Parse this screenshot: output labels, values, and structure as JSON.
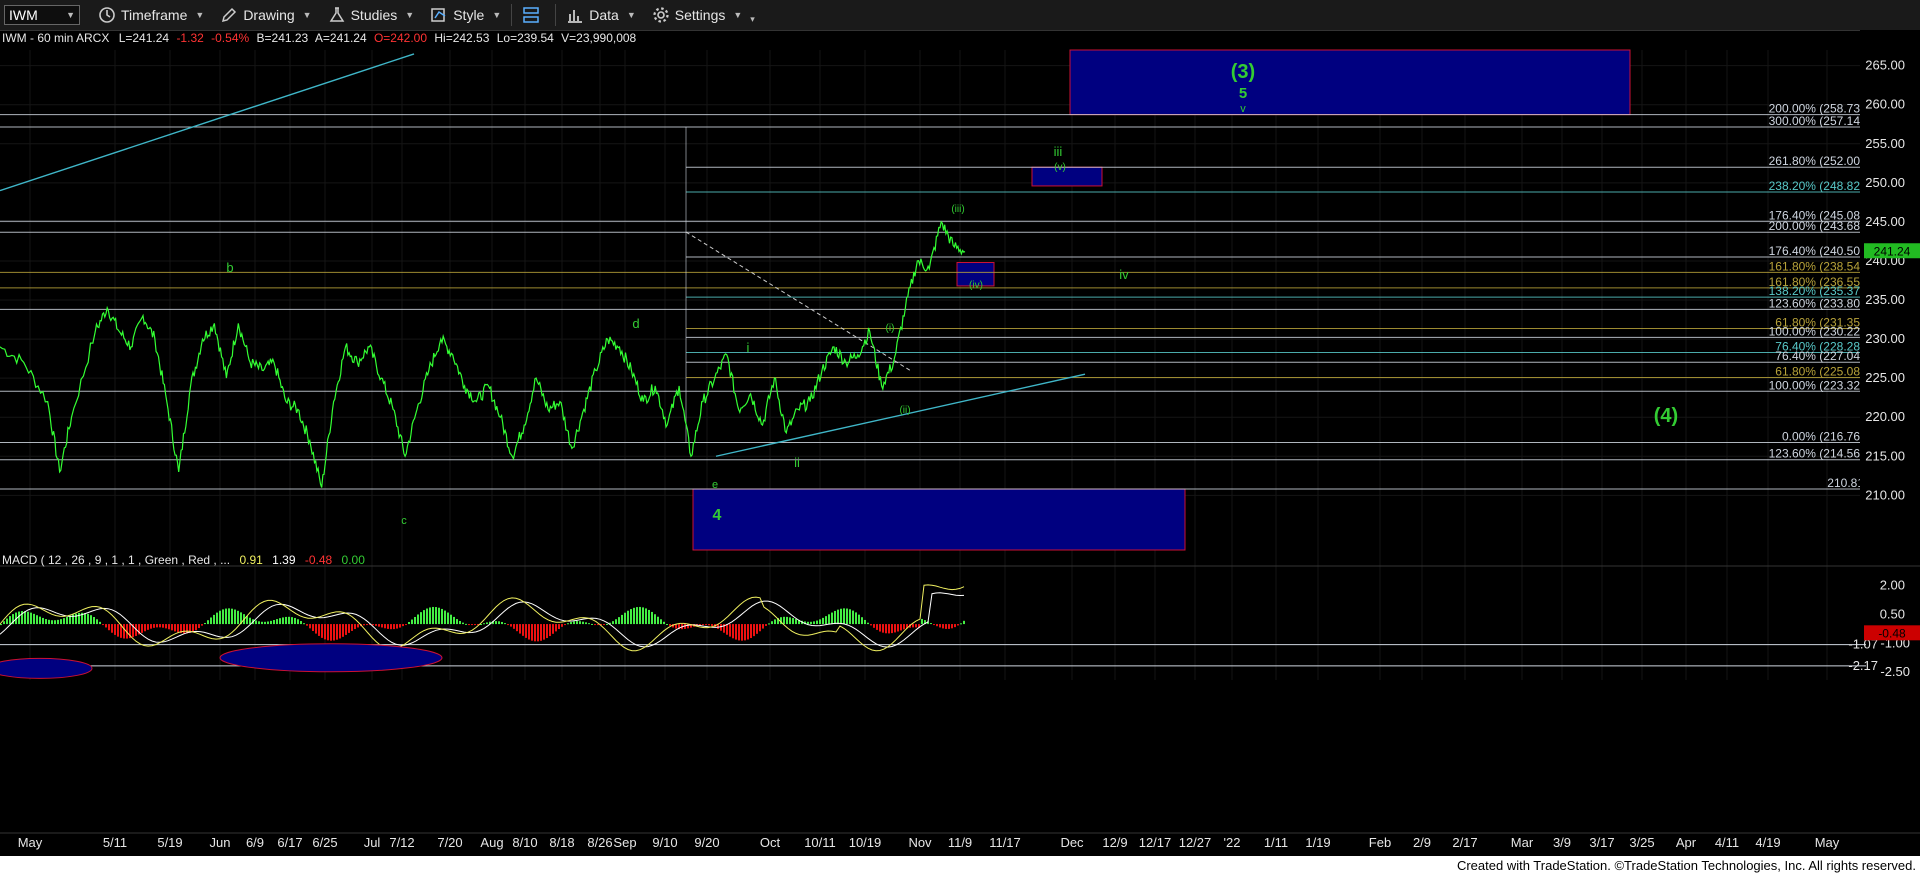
{
  "toolbar": {
    "symbol": "IWM",
    "timeframe_label": "Timeframe",
    "drawing_label": "Drawing",
    "studies_label": "Studies",
    "style_label": "Style",
    "data_label": "Data",
    "settings_label": "Settings"
  },
  "header": {
    "info": "IWM - 60 min  ARCX",
    "last": "L=241.24",
    "change": "-1.32",
    "change_pct": "-0.54%",
    "bid": "B=241.23",
    "ask": "A=241.24",
    "open": "O=242.00",
    "high": "Hi=242.53",
    "low": "Lo=239.54",
    "volume": "V=23,990,008"
  },
  "macd": {
    "title": "MACD ( 12 , 26 , 9 , 1 , 1 , Green , Red , ...",
    "v1": "0.91",
    "v2": "1.39",
    "v3": "-0.48",
    "v4": "0.00"
  },
  "colors": {
    "price": "#33ff33",
    "wave_label": "#33cc33",
    "box_fill": "#000080",
    "box_border": "#cc1133",
    "fib_white": "#cfd6e0",
    "fib_cyan": "#58c8c8",
    "fib_gold": "#b8a33a",
    "trendline": "#3fb6c8",
    "macd_up": "#44ee44",
    "macd_down": "#ee1111",
    "macd_line1": "#f0f060",
    "macd_line2": "#ffffff",
    "last_price_tag": "#22bb22"
  },
  "footer": {
    "text": "Created with TradeStation. ©TradeStation Technologies, Inc. All rights reserved."
  },
  "chart_data": {
    "type": "line",
    "title": "IWM - 60 min ARCX",
    "xlabel": "",
    "ylabel": "",
    "ylim": [
      203,
      267
    ],
    "x_tick_labels": [
      "May",
      "5/11",
      "5/19",
      "Jun",
      "6/9",
      "6/17",
      "6/25",
      "Jul",
      "7/12",
      "7/20",
      "Aug",
      "8/10",
      "8/18",
      "8/26",
      "Sep",
      "9/10",
      "9/20",
      "Oct",
      "10/11",
      "10/19",
      "Nov",
      "11/9",
      "11/17",
      "Dec",
      "12/9",
      "12/17",
      "12/27",
      "'22",
      "1/11",
      "1/19",
      "Feb",
      "2/9",
      "2/17",
      "Mar",
      "3/9",
      "3/17",
      "3/25",
      "Apr",
      "4/11",
      "4/19",
      "May"
    ],
    "y_ticks": [
      210,
      215,
      220,
      225,
      230,
      235,
      240,
      245,
      250,
      255,
      260,
      265
    ],
    "last_price": "241.24",
    "series": [
      {
        "points": [
          [
            0,
            229
          ],
          [
            2,
            227
          ],
          [
            4,
            222
          ],
          [
            5,
            213
          ],
          [
            6,
            220
          ],
          [
            8,
            231
          ],
          [
            9,
            234
          ],
          [
            10,
            231
          ],
          [
            11,
            229
          ],
          [
            12,
            233
          ],
          [
            13,
            230
          ],
          [
            14,
            222
          ],
          [
            15,
            213
          ],
          [
            16,
            224
          ],
          [
            17,
            230
          ],
          [
            18,
            232
          ],
          [
            19,
            225
          ],
          [
            20,
            232
          ],
          [
            21,
            227
          ],
          [
            22,
            226
          ],
          [
            23,
            227
          ],
          [
            24,
            222
          ],
          [
            25,
            221
          ],
          [
            26,
            217
          ],
          [
            27,
            211
          ],
          [
            28,
            222
          ],
          [
            29,
            229
          ],
          [
            30,
            227
          ],
          [
            31,
            229
          ],
          [
            32,
            225
          ],
          [
            33,
            221
          ],
          [
            34,
            215
          ],
          [
            35,
            221
          ],
          [
            36,
            226
          ],
          [
            37,
            230
          ],
          [
            38,
            228
          ],
          [
            39,
            224
          ],
          [
            40,
            222
          ],
          [
            41,
            224
          ],
          [
            42,
            220
          ],
          [
            43,
            215
          ],
          [
            44,
            219
          ],
          [
            45,
            225
          ],
          [
            46,
            221
          ],
          [
            47,
            222
          ],
          [
            48,
            216
          ],
          [
            49,
            221
          ],
          [
            50,
            226
          ],
          [
            51,
            230
          ],
          [
            52,
            229
          ],
          [
            53,
            226
          ],
          [
            54,
            222
          ],
          [
            55,
            224
          ],
          [
            56,
            219
          ],
          [
            57,
            224
          ],
          [
            58,
            215
          ],
          [
            59,
            222
          ],
          [
            60,
            225
          ],
          [
            61,
            228
          ],
          [
            62,
            221
          ],
          [
            63,
            223
          ],
          [
            64,
            219
          ],
          [
            65,
            225
          ],
          [
            66,
            218
          ],
          [
            67,
            221
          ],
          [
            68,
            222
          ],
          [
            69,
            226
          ],
          [
            70,
            229
          ],
          [
            71,
            227
          ],
          [
            72,
            228
          ],
          [
            73,
            231
          ],
          [
            74,
            224
          ],
          [
            75,
            227
          ],
          [
            76,
            234
          ],
          [
            77,
            240
          ],
          [
            78,
            239
          ],
          [
            79,
            245
          ],
          [
            80,
            242
          ],
          [
            81,
            241.2
          ]
        ]
      }
    ],
    "fib_levels": [
      {
        "label": "200.00% (258.73)",
        "value": 258.73,
        "color": "white"
      },
      {
        "label": "300.00% (257.14)",
        "value": 257.14,
        "color": "white"
      },
      {
        "label": "261.80% (252.00)",
        "value": 252.0,
        "color": "white"
      },
      {
        "label": "238.20% (248.82)",
        "value": 248.82,
        "color": "cyan"
      },
      {
        "label": "176.40% (245.08)",
        "value": 245.08,
        "color": "white"
      },
      {
        "label": "200.00% (243.68)",
        "value": 243.68,
        "color": "white"
      },
      {
        "label": "176.40% (240.50)",
        "value": 240.5,
        "color": "white"
      },
      {
        "label": "161.80% (238.54)",
        "value": 238.54,
        "color": "gold"
      },
      {
        "label": "161.80% (236.55)",
        "value": 236.55,
        "color": "gold"
      },
      {
        "label": "138.20% (235.37)",
        "value": 235.37,
        "color": "cyan"
      },
      {
        "label": "123.60% (233.80)",
        "value": 233.8,
        "color": "white"
      },
      {
        "label": "61.80% (231.35)",
        "value": 231.35,
        "color": "gold"
      },
      {
        "label": "100.00% (230.22)",
        "value": 230.22,
        "color": "white"
      },
      {
        "label": "76.40% (228.28)",
        "value": 228.28,
        "color": "cyan"
      },
      {
        "label": "76.40% (227.04)",
        "value": 227.04,
        "color": "white"
      },
      {
        "label": "61.80% (225.08)",
        "value": 225.08,
        "color": "gold"
      },
      {
        "label": "100.00% (223.32)",
        "value": 223.32,
        "color": "white"
      },
      {
        "label": "0.00% (216.76)",
        "value": 216.76,
        "color": "white"
      },
      {
        "label": "123.60% (214.56)",
        "value": 214.56,
        "color": "white"
      },
      {
        "label": "210.81",
        "value": 210.81,
        "color": "white"
      }
    ],
    "wave_labels": [
      "(3)",
      "5",
      "v",
      "iii",
      "(v)",
      "(iii)",
      "iv",
      "(iv)",
      "b",
      "d",
      "i",
      "ii",
      "(i)",
      "(ii)",
      "e",
      "c",
      "4",
      "(4)"
    ],
    "macd_ticks": [
      "2.00",
      "0.50",
      "-1.07",
      "-1.00",
      "-2.17",
      "-2.50",
      "-0.48"
    ]
  }
}
